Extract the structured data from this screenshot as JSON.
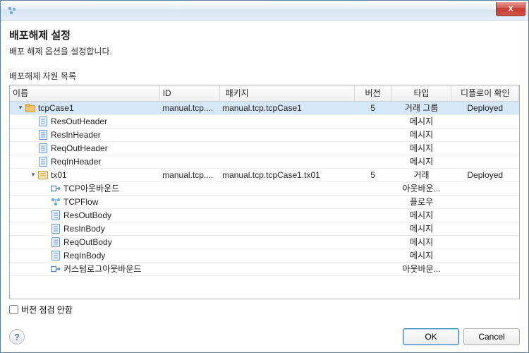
{
  "window": {
    "close_label": "X"
  },
  "header": {
    "title": "배포해제 설정",
    "description": "배포 해제 옵션을 설정합니다."
  },
  "group_label": "배포해제 자원 목록",
  "columns": {
    "name": "이름",
    "id": "ID",
    "pkg": "패키지",
    "ver": "버전",
    "type": "타입",
    "deploy": "디플로이 확인"
  },
  "rows": [
    {
      "depth": 0,
      "expander": "▾",
      "icon": "folder",
      "name": "tcpCase1",
      "id": "manual.tcp....",
      "pkg": "manual.tcp.tcpCase1",
      "ver": "5",
      "type": "거래 그룹",
      "deploy": "Deployed",
      "selected": true
    },
    {
      "depth": 1,
      "expander": "",
      "icon": "msg",
      "name": "ResOutHeader",
      "id": "",
      "pkg": "",
      "ver": "",
      "type": "메시지",
      "deploy": ""
    },
    {
      "depth": 1,
      "expander": "",
      "icon": "msg",
      "name": "ResInHeader",
      "id": "",
      "pkg": "",
      "ver": "",
      "type": "메시지",
      "deploy": ""
    },
    {
      "depth": 1,
      "expander": "",
      "icon": "msg",
      "name": "ReqOutHeader",
      "id": "",
      "pkg": "",
      "ver": "",
      "type": "메시지",
      "deploy": ""
    },
    {
      "depth": 1,
      "expander": "",
      "icon": "msg",
      "name": "ReqInHeader",
      "id": "",
      "pkg": "",
      "ver": "",
      "type": "메시지",
      "deploy": ""
    },
    {
      "depth": 1,
      "expander": "▾",
      "icon": "tx",
      "name": "tx01",
      "id": "manual.tcp....",
      "pkg": "manual.tcp.tcpCase1.tx01",
      "ver": "5",
      "type": "거래",
      "deploy": "Deployed"
    },
    {
      "depth": 2,
      "expander": "",
      "icon": "out",
      "name": "TCP아웃바운드",
      "id": "",
      "pkg": "",
      "ver": "",
      "type": "아웃바운...",
      "deploy": ""
    },
    {
      "depth": 2,
      "expander": "",
      "icon": "flow",
      "name": "TCPFlow",
      "id": "",
      "pkg": "",
      "ver": "",
      "type": "플로우",
      "deploy": ""
    },
    {
      "depth": 2,
      "expander": "",
      "icon": "msg",
      "name": "ResOutBody",
      "id": "",
      "pkg": "",
      "ver": "",
      "type": "메시지",
      "deploy": ""
    },
    {
      "depth": 2,
      "expander": "",
      "icon": "msg",
      "name": "ResInBody",
      "id": "",
      "pkg": "",
      "ver": "",
      "type": "메시지",
      "deploy": ""
    },
    {
      "depth": 2,
      "expander": "",
      "icon": "msg",
      "name": "ReqOutBody",
      "id": "",
      "pkg": "",
      "ver": "",
      "type": "메시지",
      "deploy": ""
    },
    {
      "depth": 2,
      "expander": "",
      "icon": "msg",
      "name": "ReqInBody",
      "id": "",
      "pkg": "",
      "ver": "",
      "type": "메시지",
      "deploy": ""
    },
    {
      "depth": 2,
      "expander": "",
      "icon": "out",
      "name": "커스텀로그아웃바운드",
      "id": "",
      "pkg": "",
      "ver": "",
      "type": "아웃바운...",
      "deploy": ""
    }
  ],
  "checkbox": {
    "label": "버전 점검 안함"
  },
  "buttons": {
    "help": "?",
    "ok": "OK",
    "cancel": "Cancel"
  }
}
